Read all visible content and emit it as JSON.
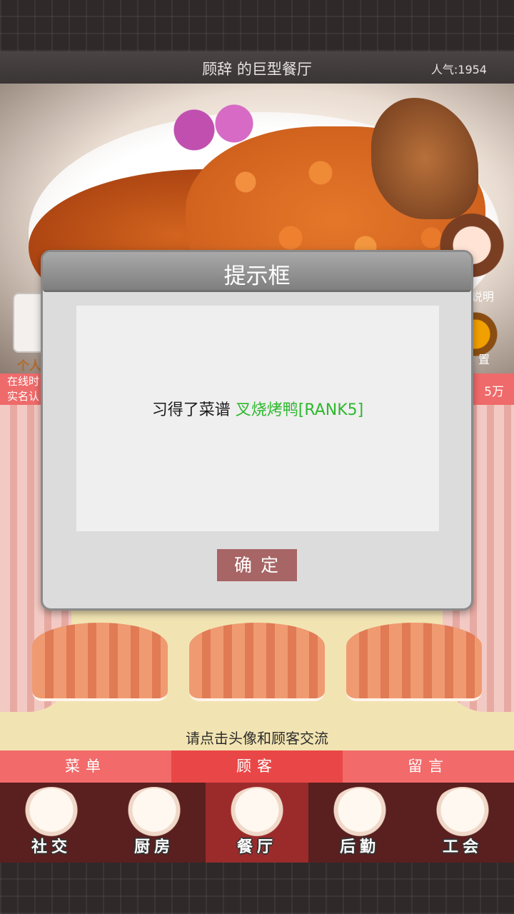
{
  "header": {
    "title": "顾辞 的巨型餐厅",
    "popularity": "人气:1954"
  },
  "side": {
    "left_label": "个人",
    "info_line1": "在线时",
    "info_line2": "实名认",
    "info_right": "5万",
    "right_label1": "说明",
    "right_label2": "置"
  },
  "room": {
    "hint": "请点击头像和顾客交流"
  },
  "tabs": [
    {
      "label": "菜单",
      "active": false
    },
    {
      "label": "顾客",
      "active": true
    },
    {
      "label": "留言",
      "active": false
    }
  ],
  "nav": [
    {
      "label": "社交",
      "icon": "noodle-bowl-icon"
    },
    {
      "label": "厨房",
      "icon": "bun-icon"
    },
    {
      "label": "餐厅",
      "icon": "rice-bowl-icon",
      "active": true
    },
    {
      "label": "后勤",
      "icon": "dumpling-icon"
    },
    {
      "label": "工会",
      "icon": "zongzi-icon"
    }
  ],
  "dialog": {
    "title": "提示框",
    "message_prefix": "习得了菜谱 ",
    "message_highlight": "叉烧烤鸭[RANK5]",
    "ok_label": "确定",
    "highlight_color": "#2db82d"
  }
}
